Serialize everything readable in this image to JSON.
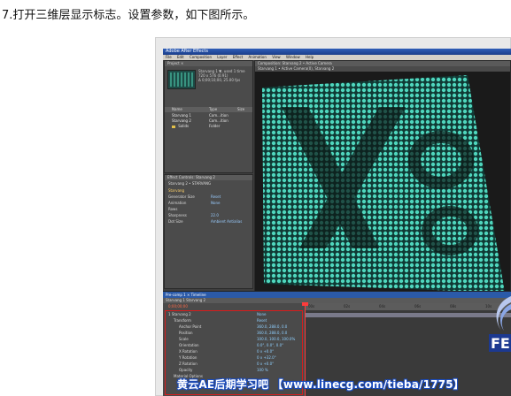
{
  "caption": "7.打开三维层显示标志。设置参数，如下图所示。",
  "app": {
    "window_title": "Adobe After Effects",
    "menu": [
      "File",
      "Edit",
      "Composition",
      "Layer",
      "Effect",
      "Animation",
      "View",
      "Window",
      "Help"
    ]
  },
  "project_panel": {
    "tab": "Project ×",
    "info": "Starvang 1 ▼, used 1 time\n720 x 576 (0.91)\nΔ 0;00;10;00, 25.00 fps",
    "columns": [
      "Name",
      "Type",
      "Size"
    ],
    "rows": [
      {
        "name": "Starvang 1",
        "type": "Com...ition"
      },
      {
        "name": "Starvang 2",
        "type": "Com...ition"
      },
      {
        "name": "Solids",
        "type": "Folder"
      }
    ]
  },
  "effect_controls": {
    "tab": "Effect Controls: Starvang 2",
    "layer": "Starvang 2 • STARVANG",
    "rows": [
      {
        "label": "Starvang",
        "value": ""
      },
      {
        "label": "Generator Size",
        "value": "Reset"
      },
      {
        "label": "Animation",
        "value": "None"
      },
      {
        "label": "Rows",
        "value": ""
      },
      {
        "label": "Sharpness",
        "value": "22.0"
      },
      {
        "label": "Dot Size",
        "value": "Ambient Antialias"
      }
    ]
  },
  "viewer": {
    "tab": "Composition: Starvang 2 • Active Camera",
    "sub_tab": "Starvang 1 • Active Camera(0), Starvang 2"
  },
  "timeline": {
    "title": "Pre-comp 1 × Timeline",
    "tabs": "Starvang 1   Starvang 2",
    "timecode": "0;00;00;00",
    "ruler_labels": [
      "00s",
      "02s",
      "04s",
      "06s",
      "08s",
      "10s"
    ],
    "rows": [
      {
        "label": "1  Starvang 2",
        "value": "None"
      },
      {
        "label": "Transform",
        "value": "Reset"
      },
      {
        "label": "Anchor Point",
        "value": "360.0, 288.0, 0.0"
      },
      {
        "label": "Position",
        "value": "360.0, 288.0, 0.0"
      },
      {
        "label": "Scale",
        "value": "100.0, 100.0, 100.0%"
      },
      {
        "label": "Orientation",
        "value": "0.0°, 0.0°, 0.0°"
      },
      {
        "label": "X Rotation",
        "value": "0 x +0.0°"
      },
      {
        "label": "Y Rotation",
        "value": "0 x +32.0°"
      },
      {
        "label": "Z Rotation",
        "value": "0 x +0.0°"
      },
      {
        "label": "Opacity",
        "value": "100 %"
      },
      {
        "label": "Material Options",
        "value": ""
      }
    ]
  },
  "watermark": "黄云AE后期学习吧 【www.linecg.com/tieba/1775】",
  "logo_text": "FE",
  "colors": {
    "dot_color": "#4fd6bd",
    "highlight_red": "#d81c1c",
    "titlebar_blue": "#2f5fb8"
  }
}
